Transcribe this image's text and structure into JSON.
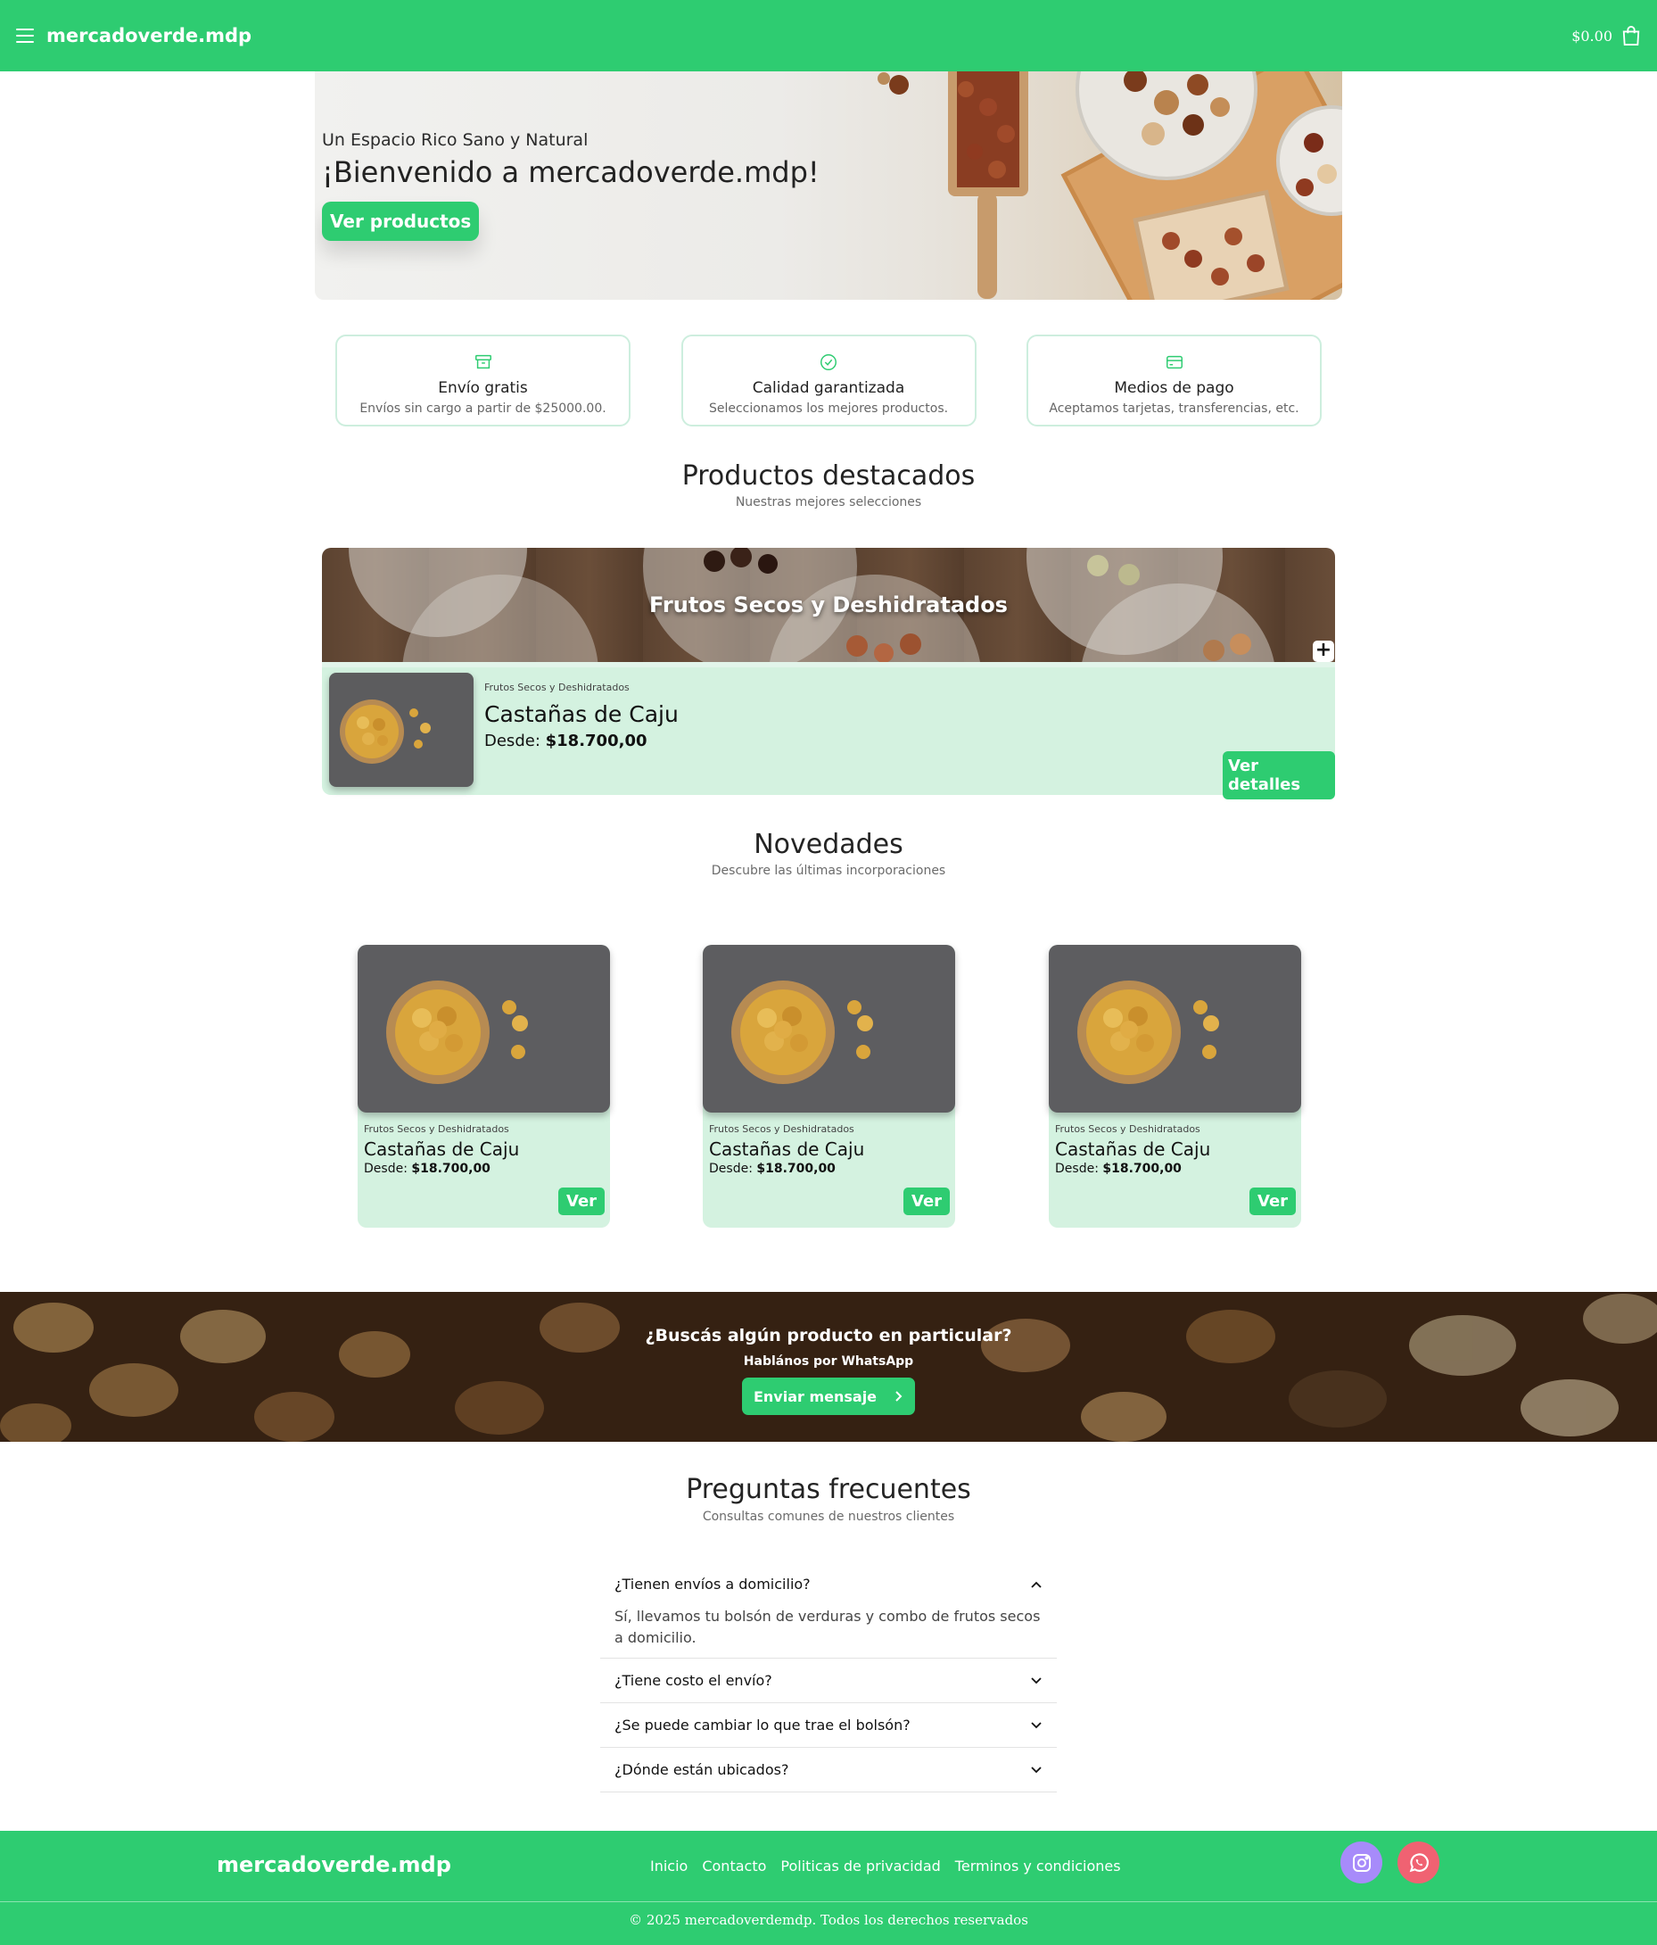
{
  "header": {
    "brand": "mercadoverde.mdp",
    "cart_total": "$0.00",
    "menu_icon": "hamburger-menu-icon",
    "cart_icon": "shopping-bag-icon",
    "accent_color": "#2ecc71"
  },
  "hero": {
    "subtitle": "Un Espacio Rico Sano y Natural",
    "title": "¡Bienvenido a mercadoverde.mdp!",
    "button_label": "Ver productos"
  },
  "features": [
    {
      "icon": "archive-box-icon",
      "title": "Envío gratis",
      "description": "Envíos sin cargo a partir de $25000.00."
    },
    {
      "icon": "check-circle-icon",
      "title": "Calidad garantizada",
      "description": "Seleccionamos los mejores productos."
    },
    {
      "icon": "credit-card-icon",
      "title": "Medios de pago",
      "description": "Aceptamos tarjetas, transferencias, etc."
    }
  ],
  "featured": {
    "title": "Productos destacados",
    "subtitle": "Nuestras mejores selecciones",
    "category": {
      "name": "Frutos Secos y Deshidratados",
      "expand_label": "+",
      "product": {
        "category": "Frutos Secos y Deshidratados",
        "name": "Castañas de Caju",
        "price_prefix": "Desde:",
        "price": "$18.700,00",
        "button_label": "Ver detalles"
      }
    }
  },
  "novedades": {
    "title": "Novedades",
    "subtitle": "Descubre las últimas incorporaciones",
    "products": [
      {
        "category": "Frutos Secos y Deshidratados",
        "name": "Castañas de Caju",
        "price_prefix": "Desde:",
        "price": "$18.700,00",
        "button_label": "Ver"
      },
      {
        "category": "Frutos Secos y Deshidratados",
        "name": "Castañas de Caju",
        "price_prefix": "Desde:",
        "price": "$18.700,00",
        "button_label": "Ver"
      },
      {
        "category": "Frutos Secos y Deshidratados",
        "name": "Castañas de Caju",
        "price_prefix": "Desde:",
        "price": "$18.700,00",
        "button_label": "Ver"
      }
    ]
  },
  "cta": {
    "title": "¿Buscás algún producto en particular?",
    "subtitle": "Hablános por WhatsApp",
    "button_label": "Enviar mensaje"
  },
  "faq": {
    "title": "Preguntas frecuentes",
    "subtitle": "Consultas comunes de nuestros clientes",
    "items": [
      {
        "question": "¿Tienen envíos a domicilio?",
        "answer": "Sí, llevamos tu bolsón de verduras y combo de frutos secos a domicilio.",
        "expanded": true
      },
      {
        "question": "¿Tiene costo el envío?",
        "expanded": false
      },
      {
        "question": "¿Se puede cambiar lo que trae el bolsón?",
        "expanded": false
      },
      {
        "question": "¿Dónde están ubicados?",
        "expanded": false
      }
    ]
  },
  "footer": {
    "brand": "mercadoverde.mdp",
    "links": [
      "Inicio",
      "Contacto",
      "Politicas de privacidad",
      "Terminos y condiciones"
    ],
    "social": [
      {
        "icon": "instagram-icon",
        "color": "#a78bfa"
      },
      {
        "icon": "whatsapp-icon",
        "color": "#f06272"
      }
    ],
    "copyright": "© 2025 mercadoverdemdp. Todos los derechos reservados"
  }
}
